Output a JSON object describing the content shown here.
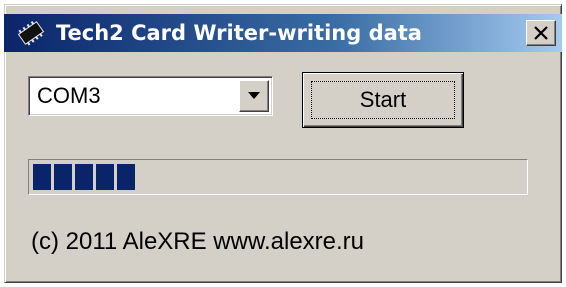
{
  "window": {
    "title": "Tech2 Card Writer-writing data",
    "icon": "chip-icon",
    "close_label": "close"
  },
  "port_select": {
    "value": "COM3",
    "arrow_icon": "dropdown-arrow-icon"
  },
  "start_button": {
    "label": "Start"
  },
  "progress": {
    "fraction": 0.21
  },
  "footer": {
    "copyright": "(c) 2011 AleXRE www.alexre.ru"
  },
  "colors": {
    "titlebar_start": "#0a246a",
    "titlebar_end": "#a6caf0",
    "progress_fill": "#0a246a",
    "face": "#d4d0c8"
  }
}
